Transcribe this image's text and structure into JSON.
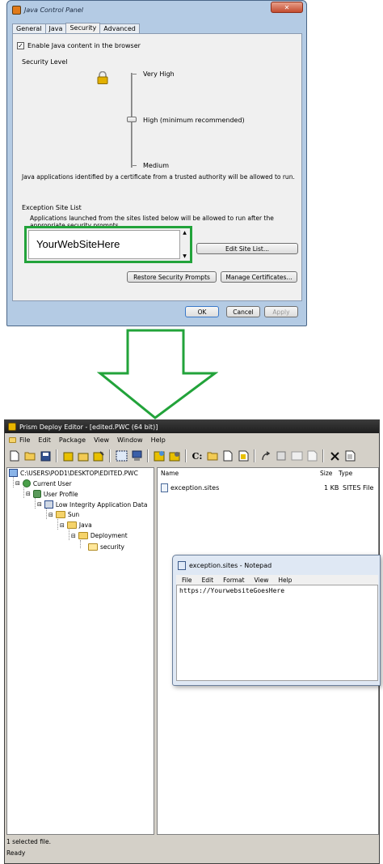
{
  "jcp": {
    "title": "Java Control Panel",
    "close_glyph": "✕",
    "tabs": [
      "General",
      "Java",
      "Security",
      "Advanced"
    ],
    "enable_label": "Enable Java content in the browser",
    "security_level_label": "Security Level",
    "levels": {
      "very_high": "Very High",
      "high": "High (minimum recommended)",
      "medium": "Medium"
    },
    "description": "Java applications identified by a certificate from a trusted authority will be allowed to run.",
    "exception_title": "Exception Site List",
    "exception_desc": "Applications launched from the sites listed below will be allowed to run after the appropriate security prompts.",
    "site_entry": "YourWebSiteHere",
    "edit_button": "Edit Site List...",
    "restore_button": "Restore Security Prompts",
    "manage_button": "Manage Certificates...",
    "ok": "OK",
    "cancel": "Cancel",
    "apply": "Apply",
    "accent_color": "#22a33a"
  },
  "prism": {
    "title": "Prism Deploy Editor - [edited.PWC (64 bit)]",
    "menu": [
      "File",
      "Edit",
      "Package",
      "View",
      "Window",
      "Help"
    ],
    "tree": {
      "root": "C:\\USERS\\POD1\\DESKTOP\\EDITED.PWC",
      "current_user": "Current User",
      "user_profile": "User Profile",
      "low_integrity": "Low Integrity Application Data",
      "sun": "Sun",
      "java": "Java",
      "deployment": "Deployment",
      "security": "security"
    },
    "columns": {
      "name": "Name",
      "size": "Size",
      "type": "Type"
    },
    "file": {
      "name": "exception.sites",
      "size": "1 KB",
      "type": "SITES File"
    },
    "status_selected": "1 selected file.",
    "status_ready": "Ready"
  },
  "notepad": {
    "title": "exception.sites - Notepad",
    "menu": [
      "File",
      "Edit",
      "Format",
      "View",
      "Help"
    ],
    "content": "https://YourwebsiteGoesHere"
  }
}
